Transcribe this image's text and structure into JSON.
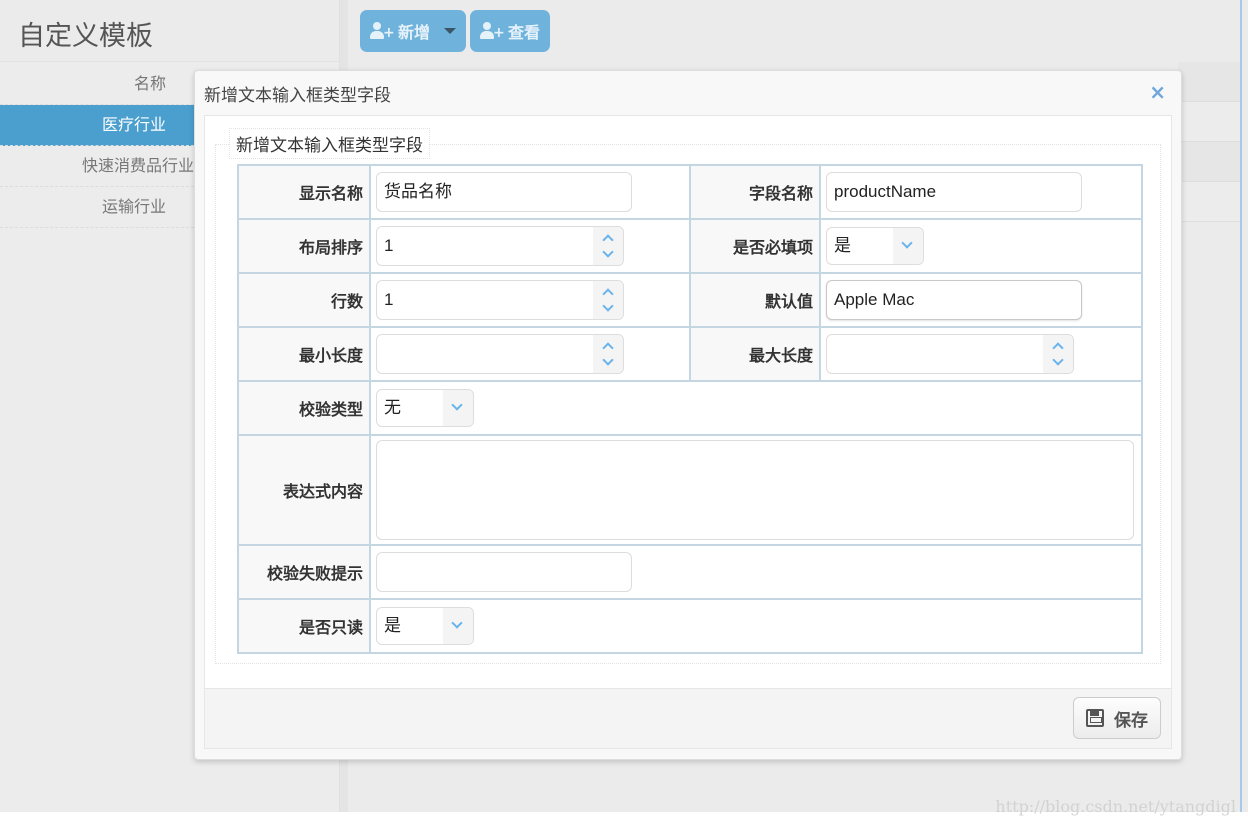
{
  "left_panel": {
    "title": "自定义模板",
    "column_header": "名称",
    "items": [
      {
        "label": "医疗行业",
        "active": true
      },
      {
        "label": "快速消费品行业",
        "active": false
      },
      {
        "label": "运输行业",
        "active": false
      }
    ]
  },
  "toolbar": {
    "add_label": "新增",
    "view_label": "查看"
  },
  "modal": {
    "title": "新增文本输入框类型字段",
    "close_icon": "×",
    "legend": "新增文本输入框类型字段",
    "fields": {
      "display_name": {
        "label": "显示名称",
        "value": "货品名称"
      },
      "field_name": {
        "label": "字段名称",
        "value": "productName"
      },
      "layout_order": {
        "label": "布局排序",
        "value": "1"
      },
      "required": {
        "label": "是否必填项",
        "value": "是"
      },
      "rows": {
        "label": "行数",
        "value": "1"
      },
      "default_value": {
        "label": "默认值",
        "value": "Apple Mac"
      },
      "min_length": {
        "label": "最小长度",
        "value": ""
      },
      "max_length": {
        "label": "最大长度",
        "value": ""
      },
      "validation_type": {
        "label": "校验类型",
        "value": "无"
      },
      "expression": {
        "label": "表达式内容",
        "value": ""
      },
      "fail_message": {
        "label": "校验失败提示",
        "value": ""
      },
      "readonly": {
        "label": "是否只读",
        "value": "是"
      }
    },
    "save_label": "保存"
  },
  "watermark": "http://blog.csdn.net/ytangdigl"
}
